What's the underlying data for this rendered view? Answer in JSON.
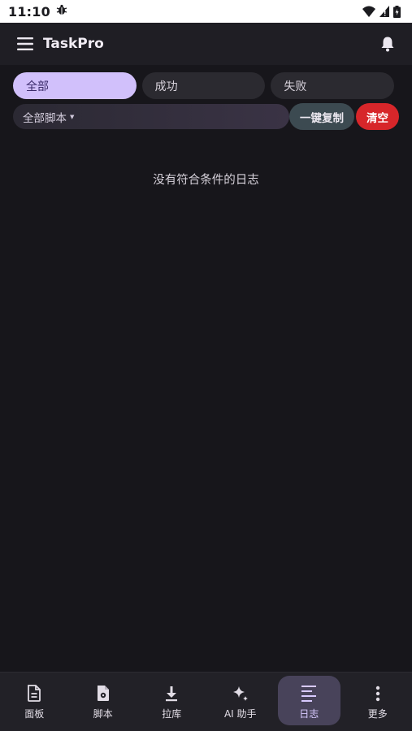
{
  "status_bar": {
    "time": "11:10",
    "notification_icon": "bug-icon",
    "icons": [
      "wifi-icon",
      "signal-icon",
      "battery-icon"
    ]
  },
  "app_bar": {
    "title": "TaskPro",
    "menu_icon": "menu-icon",
    "bell_icon": "bell-icon"
  },
  "filters": {
    "tabs": [
      {
        "label": "全部",
        "active": true
      },
      {
        "label": "成功",
        "active": false
      },
      {
        "label": "失败",
        "active": false
      }
    ]
  },
  "actions": {
    "script_select": "全部脚本",
    "copy_label": "一键复制",
    "clear_label": "清空"
  },
  "empty_state": {
    "text": "没有符合条件的日志"
  },
  "bottom_nav": {
    "items": [
      {
        "label": "面板",
        "icon": "document-icon",
        "active": false
      },
      {
        "label": "脚本",
        "icon": "script-file-icon",
        "active": false
      },
      {
        "label": "拉库",
        "icon": "download-icon",
        "active": false
      },
      {
        "label": "AI 助手",
        "icon": "sparkle-icon",
        "active": false
      },
      {
        "label": "日志",
        "icon": "log-lines-icon",
        "active": true
      },
      {
        "label": "更多",
        "icon": "more-vertical-icon",
        "active": false
      }
    ]
  },
  "colors": {
    "background": "#17161b",
    "accent": "#d1c0fb",
    "danger": "#d7262a",
    "copy_button": "#3c4a51"
  }
}
